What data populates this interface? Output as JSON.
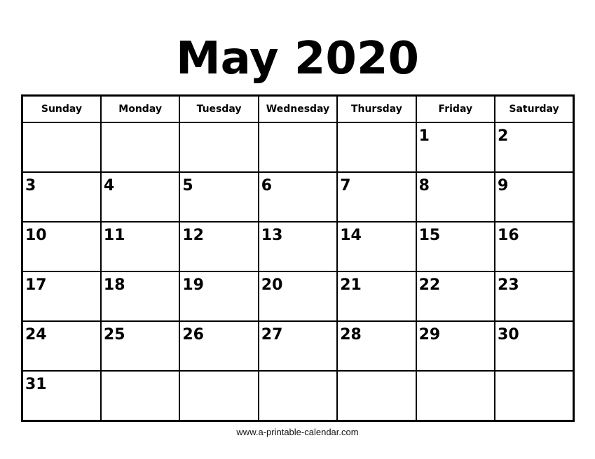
{
  "title": "May 2020",
  "weekdays": [
    "Sunday",
    "Monday",
    "Tuesday",
    "Wednesday",
    "Thursday",
    "Friday",
    "Saturday"
  ],
  "weeks": [
    [
      "",
      "",
      "",
      "",
      "",
      "1",
      "2"
    ],
    [
      "3",
      "4",
      "5",
      "6",
      "7",
      "8",
      "9"
    ],
    [
      "10",
      "11",
      "12",
      "13",
      "14",
      "15",
      "16"
    ],
    [
      "17",
      "18",
      "19",
      "20",
      "21",
      "22",
      "23"
    ],
    [
      "24",
      "25",
      "26",
      "27",
      "28",
      "29",
      "30"
    ],
    [
      "31",
      "",
      "",
      "",
      "",
      "",
      ""
    ]
  ],
  "footer": "www.a-printable-calendar.com"
}
